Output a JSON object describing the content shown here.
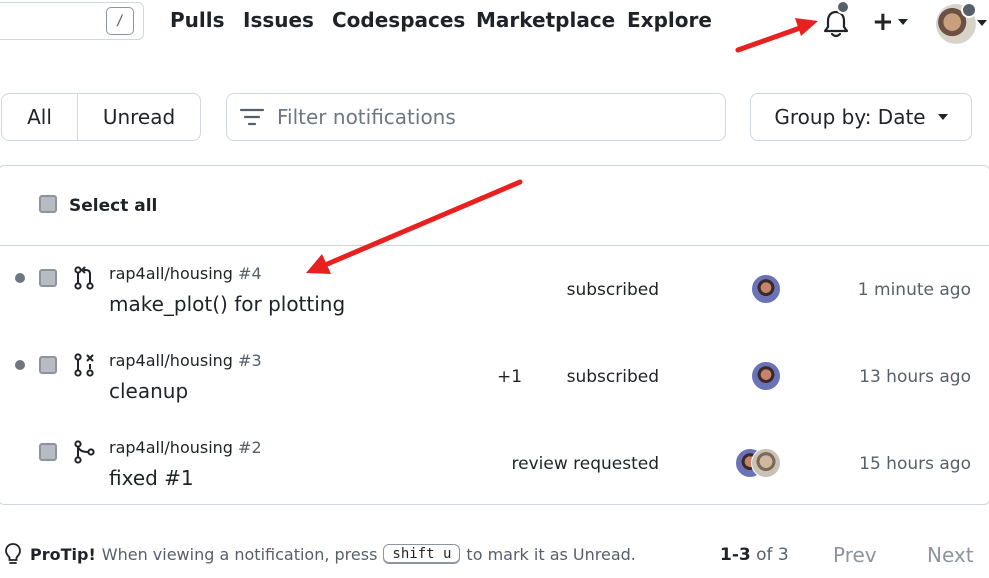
{
  "nav": {
    "search_key": "/",
    "links": [
      "Pulls",
      "Issues",
      "Codespaces",
      "Marketplace",
      "Explore"
    ],
    "icons": [
      "bell-icon",
      "plus-icon",
      "avatar"
    ]
  },
  "filters": {
    "all_label": "All",
    "unread_label": "Unread",
    "filter_placeholder": "Filter notifications",
    "group_by_label": "Group by: Date"
  },
  "list": {
    "select_all_label": "Select all",
    "rows": [
      {
        "repo": "rap4all/housing",
        "number": "#4",
        "title": "make_plot() for plotting",
        "extra": "",
        "reason": "subscribed",
        "time": "1 minute ago",
        "unread": true,
        "icon": "pull-request-icon",
        "avatars": 1
      },
      {
        "repo": "rap4all/housing",
        "number": "#3",
        "title": "cleanup",
        "extra": "+1",
        "reason": "subscribed",
        "time": "13 hours ago",
        "unread": true,
        "icon": "pull-request-closed-icon",
        "avatars": 1
      },
      {
        "repo": "rap4all/housing",
        "number": "#2",
        "title": "fixed #1",
        "extra": "",
        "reason": "review requested",
        "time": "15 hours ago",
        "unread": false,
        "icon": "pull-request-merged-icon",
        "avatars": 2
      }
    ]
  },
  "footer": {
    "protip_label": "ProTip!",
    "protip_before": "When viewing a notification, press",
    "protip_key": "shift u",
    "protip_after": "to mark it as Unread.",
    "range": "1-3",
    "of_label": "of 3",
    "prev_label": "Prev",
    "next_label": "Next"
  },
  "colors": {
    "annotation_arrow": "#e8201f",
    "border": "#d0d7de",
    "muted": "#57606a"
  }
}
